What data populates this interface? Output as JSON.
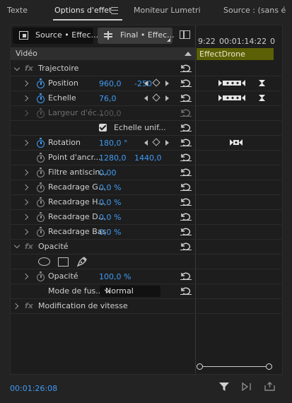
{
  "tabs": [
    {
      "label": "Texte"
    },
    {
      "label": "Options d'effet"
    },
    {
      "label": "Moniteur Lumetri"
    },
    {
      "label": "Source : (sans é"
    }
  ],
  "clips": {
    "source": "Source • Effec...",
    "final": "Final • Effec..."
  },
  "timeline": {
    "ruler_left": "9:22",
    "ruler_mid": "00:01:14:22",
    "ruler_right": "0",
    "clip_name": "EffectDrone"
  },
  "section": {
    "title": "Vidéo"
  },
  "effects": {
    "trajectoire": "Trajectoire",
    "opacite": "Opacité",
    "vitesse": "Modification de vitesse"
  },
  "params": {
    "position": {
      "label": "Position",
      "x": "960,0",
      "y": "-250"
    },
    "echelle": {
      "label": "Echelle",
      "value": "76,0"
    },
    "largeur": {
      "label": "Largeur d'éc...",
      "value": "100,0"
    },
    "uniforme": {
      "label": "Echelle unif..."
    },
    "rotation": {
      "label": "Rotation",
      "value": "180,0 °"
    },
    "ancrage": {
      "label": "Point d'ancr...",
      "x": "1280,0",
      "y": "1440,0"
    },
    "filtre": {
      "label": "Filtre antiscin...",
      "value": "0,00"
    },
    "recadrage_g": {
      "label": "Recadrage G...",
      "value": "0,0 %"
    },
    "recadrage_h": {
      "label": "Recadrage H...",
      "value": "0,0 %"
    },
    "recadrage_d": {
      "label": "Recadrage D...",
      "value": "0,0 %"
    },
    "recadrage_b": {
      "label": "Recadrage Bas",
      "value": "0,0 %"
    },
    "opacite": {
      "label": "Opacité",
      "value": "100,0 %"
    },
    "fusion": {
      "label": "Mode de fus...",
      "value": "Normal"
    }
  },
  "footer": {
    "timecode": "00:01:26:08"
  },
  "colors": {
    "accent": "#3f9bf5",
    "clip_bar": "#5b6007"
  }
}
